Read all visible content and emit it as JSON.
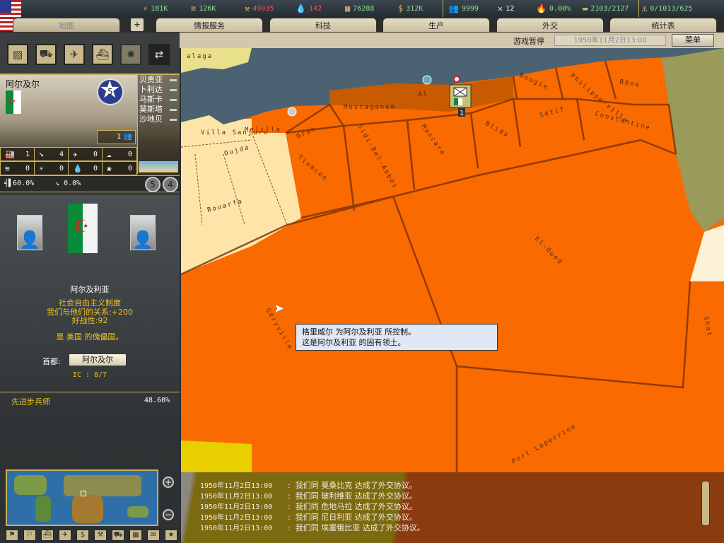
{
  "resources": {
    "energy": "181K",
    "metal": "126K",
    "rare": "49035",
    "oil": "142",
    "supplies": "76288",
    "money": "312K",
    "manpower": "9999",
    "diplomacy": "12",
    "dissent": "0.00%",
    "transport": "2103/2127",
    "convoys": "0/1013/625"
  },
  "tabs": [
    "地图",
    "情报服务",
    "科技",
    "生产",
    "外交",
    "统计表"
  ],
  "status": {
    "paused": "游戏暂停",
    "date": "1950年11月2日13:00",
    "menu": "菜单"
  },
  "province": {
    "name": "阿尔及尔",
    "star_level": "5",
    "neighbors": [
      "贝贾亚",
      "卜利达",
      "马斯卡",
      "莫斯塔",
      "沙地贝"
    ],
    "units": "1",
    "stats": [
      "1",
      "4",
      "0",
      "0",
      "0",
      "0",
      "0",
      "0"
    ],
    "supply_pct": "60.0%",
    "partisan_pct": "0.0%",
    "naval_base": "5",
    "air_base": "4"
  },
  "country": {
    "name": "阿尔及利亚",
    "government": "社会自由主义制度",
    "relation": "我们与他们的关系:+200",
    "belligerence": "好战性:92",
    "puppet": "是 美国 的傀儡国。",
    "capital_label": "首都:",
    "capital": "阿尔及尔",
    "ic": "IC : 8/7"
  },
  "research": {
    "name": "先进步兵师",
    "progress": "48.60%"
  },
  "map": {
    "labels": [
      "alaga",
      "Oran",
      "Mostaganem",
      "Al",
      "Bougie",
      "Philippe-ville",
      "Bône",
      "Sidi-Bel-Abbès",
      "Mascara",
      "Blida",
      "Sétif",
      "Constantine",
      "Tlemcen",
      "Oujda",
      "Villa Sanjuro",
      "Melilla",
      "Bouarfa",
      "El-Oued",
      "Géryville",
      "Port Laperrine",
      "Ghat"
    ],
    "unit_count": "1"
  },
  "tooltip": {
    "line1": "格里威尔 为阿尔及利亚 所控制。",
    "line2": "这是阿尔及利亚 的固有领土。"
  },
  "log": [
    {
      "date": "1950年11月2日13:00",
      "text": ":  我们同 莫桑比克 达成了外交协议。"
    },
    {
      "date": "1950年11月2日13:00",
      "text": ":  我们同 玻利维亚 达成了外交协议。"
    },
    {
      "date": "1950年11月2日13:00",
      "text": ":  我们同 危地马拉 达成了外交协议。"
    },
    {
      "date": "1950年11月2日13:00",
      "text": ":  我们同 尼日利亚 达成了外交协议。"
    },
    {
      "date": "1950年11月2日13:00",
      "text": ":  我们同 埃塞俄比亚 达成了外交协议。"
    }
  ],
  "colors": {
    "algeria": "#f96a00",
    "capital_region": "#c85a00",
    "morocco": "#fde4a8",
    "tunisia": "#9a9a5a",
    "sea": "#4a6272"
  }
}
